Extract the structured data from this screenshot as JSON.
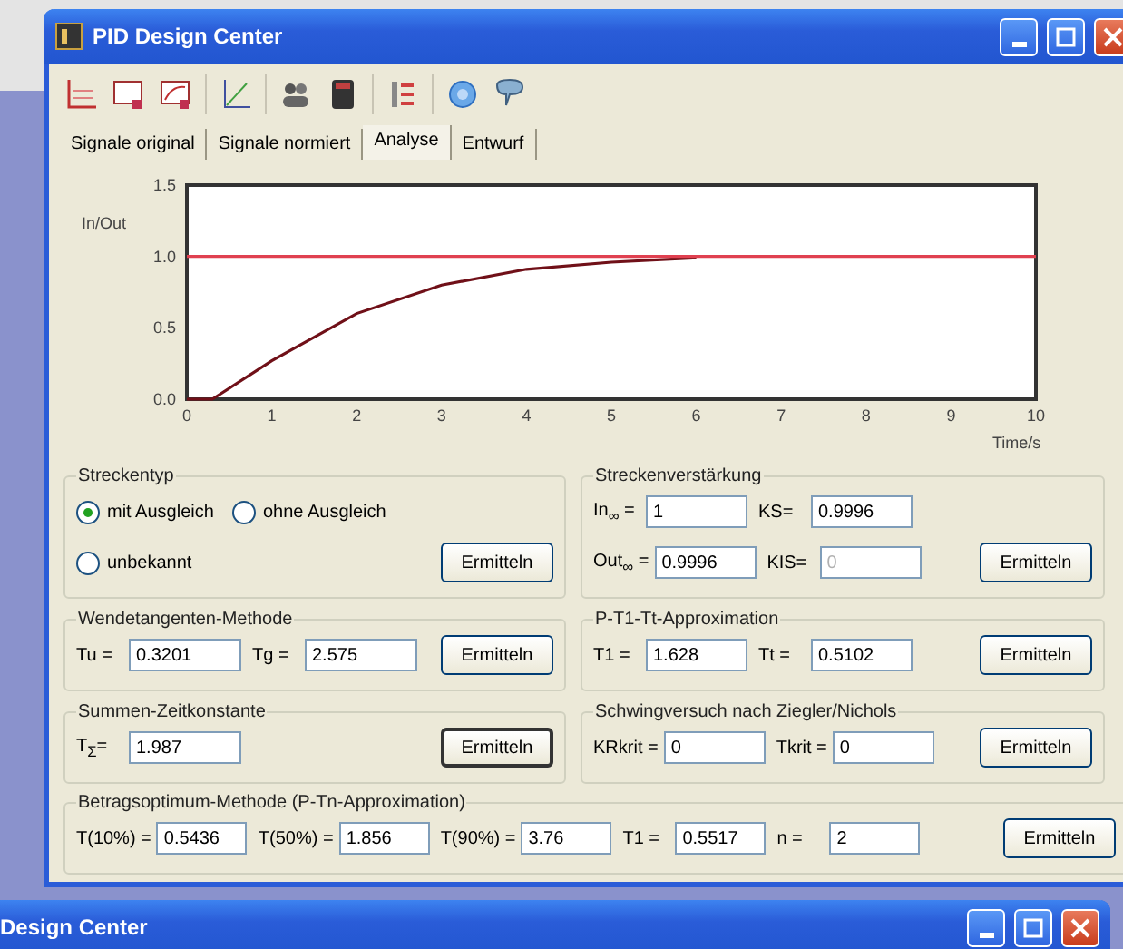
{
  "window": {
    "title": "PID Design Center"
  },
  "tabs": [
    {
      "label": "Signale original",
      "selected": false
    },
    {
      "label": "Signale normiert",
      "selected": false
    },
    {
      "label": "Analyse",
      "selected": true
    },
    {
      "label": "Entwurf",
      "selected": false
    }
  ],
  "plot": {
    "chart_data": {
      "type": "line",
      "xlabel": "Time/s",
      "ylabel": "In/Out",
      "x": [
        0,
        0.3,
        1,
        2,
        3,
        4,
        5,
        6,
        7,
        8,
        9,
        10
      ],
      "xlim": [
        0,
        10
      ],
      "ylim": [
        0,
        1.5
      ],
      "xticks": [
        0,
        1,
        2,
        3,
        4,
        5,
        6,
        7,
        8,
        9,
        10
      ],
      "yticks": [
        {
          "value": 0,
          "label": "0.0"
        },
        {
          "value": 0.5,
          "label": "0.5"
        },
        {
          "value": 1,
          "label": "1.0"
        },
        {
          "value": 1.5,
          "label": "1.5"
        }
      ],
      "series": [
        {
          "color": "#701018",
          "values": [
            0,
            0,
            0.27,
            0.6,
            0.8,
            0.91,
            0.96,
            0.99,
            null,
            null,
            null,
            null
          ]
        },
        {
          "color": "#e04050",
          "values": [
            1,
            1,
            1,
            1,
            1,
            1,
            1,
            1,
            1,
            1,
            1,
            1
          ]
        }
      ]
    }
  },
  "left_groups": [
    {
      "kind": "radio",
      "title": "Streckentyp",
      "rows": [
        [
          {
            "label": "mit Ausgleich",
            "selected": true
          },
          {
            "label": "ohne Ausgleich",
            "selected": false
          }
        ],
        [
          {
            "label": "unbekannt",
            "selected": false
          }
        ]
      ],
      "button": {
        "label": "Ermitteln",
        "focused": false
      }
    },
    {
      "kind": "fields",
      "title": "Wendetangenten-Methode",
      "rows": [
        [
          {
            "label": "Tu =",
            "value": "0.3201",
            "disabled": false
          },
          {
            "label": "Tg =",
            "value": "2.575",
            "disabled": false
          }
        ]
      ],
      "button": {
        "label": "Ermitteln",
        "focused": false
      }
    },
    {
      "kind": "fields",
      "title": "Summen-Zeitkonstante",
      "rows": [
        [
          {
            "label": "T$_{Σ}$=",
            "value": "1.987",
            "disabled": false
          }
        ]
      ],
      "button": {
        "label": "Ermitteln",
        "focused": true
      }
    }
  ],
  "right_groups": [
    {
      "kind": "fields",
      "title": "Streckenverstärkung",
      "rows": [
        [
          {
            "label": "In$_{∞}$ =",
            "value": "1",
            "disabled": false
          },
          {
            "label": "KS=",
            "value": "0.9996",
            "disabled": false
          }
        ],
        [
          {
            "label": "Out$_{∞}$ =",
            "value": "0.9996",
            "disabled": false
          },
          {
            "label": "KIS=",
            "value": "0",
            "disabled": true
          }
        ]
      ],
      "button": {
        "label": "Ermitteln",
        "focused": false
      }
    },
    {
      "kind": "fields",
      "title": "P-T1-Tt-Approximation",
      "rows": [
        [
          {
            "label": "T1 =",
            "value": "1.628",
            "disabled": false
          },
          {
            "label": "Tt =",
            "value": "0.5102",
            "disabled": false
          }
        ]
      ],
      "button": {
        "label": "Ermitteln",
        "focused": false
      }
    },
    {
      "kind": "fields",
      "title": "Schwingversuch nach Ziegler/Nichols",
      "rows": [
        [
          {
            "label": "KRkrit =",
            "value": "0",
            "disabled": false
          },
          {
            "label": "Tkrit =",
            "value": "0",
            "disabled": false
          }
        ]
      ],
      "button": {
        "label": "Ermitteln",
        "focused": false
      }
    }
  ],
  "bottom_group": {
    "kind": "fields",
    "title": "Betragsoptimum-Methode (P-Tn-Approximation)",
    "rows": [
      [
        {
          "label": "T(10%) =",
          "value": "0.5436",
          "disabled": false
        },
        {
          "label": "T(50%) =",
          "value": "1.856",
          "disabled": false
        },
        {
          "label": "T(90%) =",
          "value": "3.76",
          "disabled": false
        },
        {
          "label": "T1 =",
          "value": "0.5517",
          "disabled": false
        },
        {
          "label": "n =",
          "value": "2",
          "disabled": false
        }
      ]
    ],
    "button": {
      "label": "Ermitteln",
      "focused": false
    }
  },
  "second_window": {
    "title": "Design Center"
  }
}
